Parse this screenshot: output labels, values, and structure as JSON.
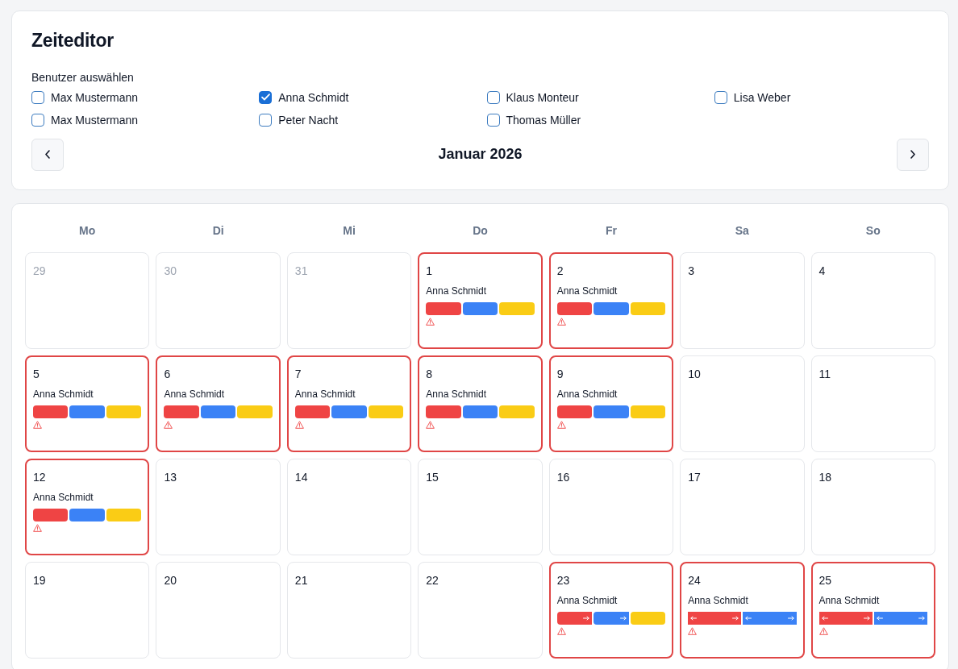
{
  "title": "Zeiteditor",
  "user_picker": {
    "label": "Benutzer auswählen",
    "users": [
      {
        "name": "Max Mustermann",
        "checked": false
      },
      {
        "name": "Anna Schmidt",
        "checked": true
      },
      {
        "name": "Klaus Monteur",
        "checked": false
      },
      {
        "name": "Lisa Weber",
        "checked": false
      },
      {
        "name": "Max Mustermann",
        "checked": false
      },
      {
        "name": "Peter Nacht",
        "checked": false
      },
      {
        "name": "Thomas Müller",
        "checked": false
      }
    ]
  },
  "month_nav": {
    "label": "Januar 2026"
  },
  "calendar": {
    "weekdays": [
      "Mo",
      "Di",
      "Mi",
      "Do",
      "Fr",
      "Sa",
      "So"
    ],
    "days": [
      {
        "day": "29",
        "in_month": false,
        "conflict": false
      },
      {
        "day": "30",
        "in_month": false,
        "conflict": false
      },
      {
        "day": "31",
        "in_month": false,
        "conflict": false
      },
      {
        "day": "1",
        "in_month": true,
        "conflict": true,
        "entries": [
          {
            "user": "Anna Schmidt",
            "segments": [
              {
                "color": "#ef4444",
                "continues_before": false,
                "continues_after": false
              },
              {
                "color": "#3b82f6",
                "continues_before": false,
                "continues_after": false
              },
              {
                "color": "#facc15",
                "continues_before": false,
                "continues_after": false
              }
            ]
          }
        ]
      },
      {
        "day": "2",
        "in_month": true,
        "conflict": true,
        "entries": [
          {
            "user": "Anna Schmidt",
            "segments": [
              {
                "color": "#ef4444",
                "continues_before": false,
                "continues_after": false
              },
              {
                "color": "#3b82f6",
                "continues_before": false,
                "continues_after": false
              },
              {
                "color": "#facc15",
                "continues_before": false,
                "continues_after": false
              }
            ]
          }
        ]
      },
      {
        "day": "3",
        "in_month": true,
        "conflict": false
      },
      {
        "day": "4",
        "in_month": true,
        "conflict": false
      },
      {
        "day": "5",
        "in_month": true,
        "conflict": true,
        "entries": [
          {
            "user": "Anna Schmidt",
            "segments": [
              {
                "color": "#ef4444",
                "continues_before": false,
                "continues_after": false
              },
              {
                "color": "#3b82f6",
                "continues_before": false,
                "continues_after": false
              },
              {
                "color": "#facc15",
                "continues_before": false,
                "continues_after": false
              }
            ]
          }
        ]
      },
      {
        "day": "6",
        "in_month": true,
        "conflict": true,
        "entries": [
          {
            "user": "Anna Schmidt",
            "segments": [
              {
                "color": "#ef4444",
                "continues_before": false,
                "continues_after": false
              },
              {
                "color": "#3b82f6",
                "continues_before": false,
                "continues_after": false
              },
              {
                "color": "#facc15",
                "continues_before": false,
                "continues_after": false
              }
            ]
          }
        ]
      },
      {
        "day": "7",
        "in_month": true,
        "conflict": true,
        "entries": [
          {
            "user": "Anna Schmidt",
            "segments": [
              {
                "color": "#ef4444",
                "continues_before": false,
                "continues_after": false
              },
              {
                "color": "#3b82f6",
                "continues_before": false,
                "continues_after": false
              },
              {
                "color": "#facc15",
                "continues_before": false,
                "continues_after": false
              }
            ]
          }
        ]
      },
      {
        "day": "8",
        "in_month": true,
        "conflict": true,
        "entries": [
          {
            "user": "Anna Schmidt",
            "segments": [
              {
                "color": "#ef4444",
                "continues_before": false,
                "continues_after": false
              },
              {
                "color": "#3b82f6",
                "continues_before": false,
                "continues_after": false
              },
              {
                "color": "#facc15",
                "continues_before": false,
                "continues_after": false
              }
            ]
          }
        ]
      },
      {
        "day": "9",
        "in_month": true,
        "conflict": true,
        "entries": [
          {
            "user": "Anna Schmidt",
            "segments": [
              {
                "color": "#ef4444",
                "continues_before": false,
                "continues_after": false
              },
              {
                "color": "#3b82f6",
                "continues_before": false,
                "continues_after": false
              },
              {
                "color": "#facc15",
                "continues_before": false,
                "continues_after": false
              }
            ]
          }
        ]
      },
      {
        "day": "10",
        "in_month": true,
        "conflict": false
      },
      {
        "day": "11",
        "in_month": true,
        "conflict": false
      },
      {
        "day": "12",
        "in_month": true,
        "conflict": true,
        "entries": [
          {
            "user": "Anna Schmidt",
            "segments": [
              {
                "color": "#ef4444",
                "continues_before": false,
                "continues_after": false
              },
              {
                "color": "#3b82f6",
                "continues_before": false,
                "continues_after": false
              },
              {
                "color": "#facc15",
                "continues_before": false,
                "continues_after": false
              }
            ]
          }
        ]
      },
      {
        "day": "13",
        "in_month": true,
        "conflict": false
      },
      {
        "day": "14",
        "in_month": true,
        "conflict": false
      },
      {
        "day": "15",
        "in_month": true,
        "conflict": false
      },
      {
        "day": "16",
        "in_month": true,
        "conflict": false
      },
      {
        "day": "17",
        "in_month": true,
        "conflict": false
      },
      {
        "day": "18",
        "in_month": true,
        "conflict": false
      },
      {
        "day": "19",
        "in_month": true,
        "conflict": false
      },
      {
        "day": "20",
        "in_month": true,
        "conflict": false
      },
      {
        "day": "21",
        "in_month": true,
        "conflict": false
      },
      {
        "day": "22",
        "in_month": true,
        "conflict": false
      },
      {
        "day": "23",
        "in_month": true,
        "conflict": true,
        "entries": [
          {
            "user": "Anna Schmidt",
            "segments": [
              {
                "color": "#ef4444",
                "continues_before": false,
                "continues_after": true
              },
              {
                "color": "#3b82f6",
                "continues_before": false,
                "continues_after": true
              },
              {
                "color": "#facc15",
                "continues_before": false,
                "continues_after": false
              }
            ]
          }
        ]
      },
      {
        "day": "24",
        "in_month": true,
        "conflict": true,
        "entries": [
          {
            "user": "Anna Schmidt",
            "segments": [
              {
                "color": "#ef4444",
                "continues_before": true,
                "continues_after": true
              },
              {
                "color": "#3b82f6",
                "continues_before": true,
                "continues_after": true
              }
            ]
          }
        ]
      },
      {
        "day": "25",
        "in_month": true,
        "conflict": true,
        "entries": [
          {
            "user": "Anna Schmidt",
            "segments": [
              {
                "color": "#ef4444",
                "continues_before": true,
                "continues_after": true
              },
              {
                "color": "#3b82f6",
                "continues_before": true,
                "continues_after": true
              }
            ]
          }
        ]
      }
    ]
  }
}
